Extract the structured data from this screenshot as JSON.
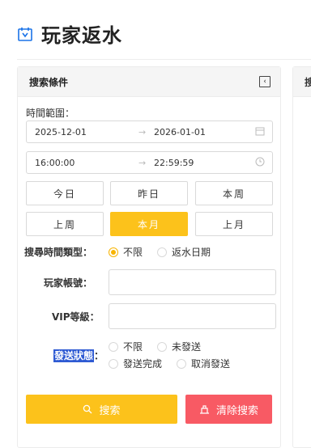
{
  "page": {
    "title": "玩家返水"
  },
  "panel": {
    "title": "搜索條件",
    "time_range_label": "時間範圍：",
    "date_range": {
      "start": "2025-12-01",
      "end": "2026-01-01"
    },
    "time_range": {
      "start": "16:00:00",
      "end": "22:59:59"
    },
    "quick_buttons": [
      "今日",
      "昨日",
      "本周",
      "上周",
      "本月",
      "上月"
    ],
    "active_quick": "本月",
    "search_time_type": {
      "label": "搜尋時間類型",
      "options": [
        "不限",
        "返水日期"
      ],
      "selected": "不限"
    },
    "player_account": {
      "label": "玩家帳號",
      "value": ""
    },
    "vip_level": {
      "label": "VIP等級",
      "value": ""
    },
    "send_status": {
      "label": "發送狀態",
      "options": [
        "不限",
        "未發送",
        "發送完成",
        "取消發送"
      ],
      "selected": ""
    },
    "search_button": "搜索",
    "clear_button": "清除搜索"
  },
  "second_panel": {
    "title_partial": "搜"
  },
  "colors": {
    "accent": "#fcc21b",
    "danger": "#f85a64",
    "selection": "#2f5bd3"
  }
}
